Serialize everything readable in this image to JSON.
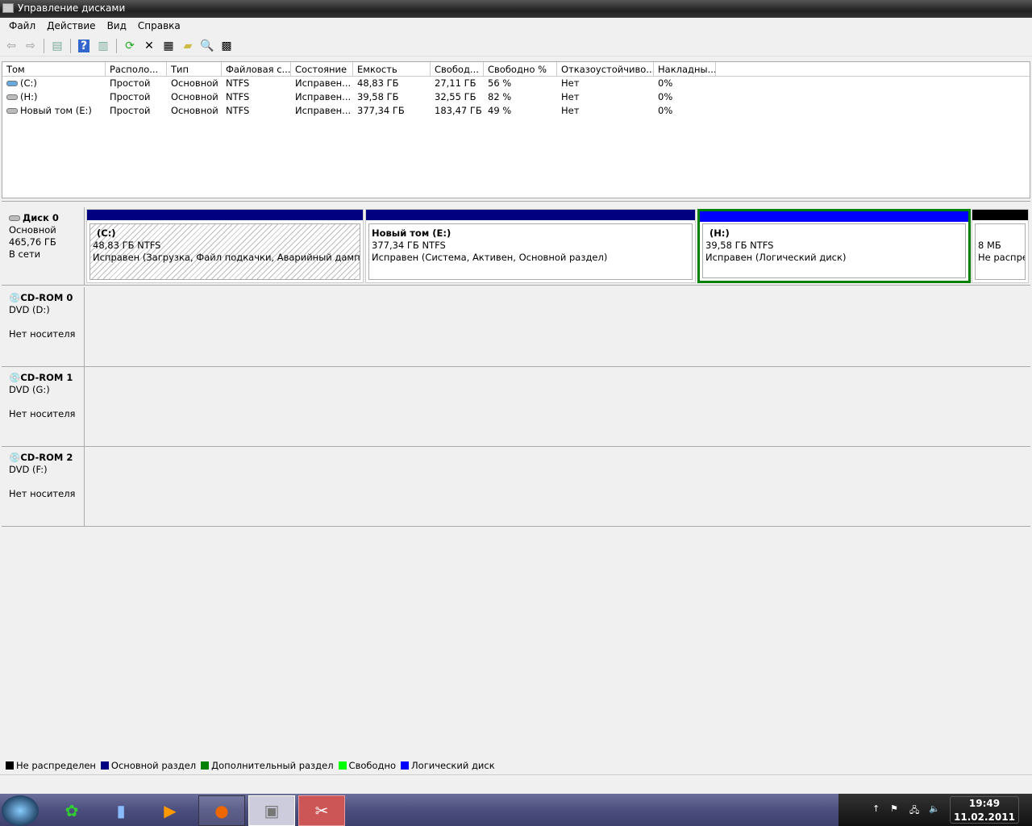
{
  "window": {
    "title": "Управление дисками"
  },
  "menu": [
    "Файл",
    "Действие",
    "Вид",
    "Справка"
  ],
  "toolbar": [
    "back-icon",
    "forward-icon",
    "console-tree-icon",
    "help-icon",
    "action-pane-icon",
    "refresh-icon",
    "delete-icon",
    "properties-icon",
    "open-icon",
    "search-icon",
    "settings-icon"
  ],
  "table": {
    "columns": [
      "Том",
      "Располо...",
      "Тип",
      "Файловая с...",
      "Состояние",
      "Емкость",
      "Свобод...",
      "Свободно %",
      "Отказоустойчиво...",
      "Накладны..."
    ],
    "rows": [
      [
        "(C:)",
        "Простой",
        "Основной",
        "NTFS",
        "Исправен...",
        "48,83 ГБ",
        "27,11 ГБ",
        "56 %",
        "Нет",
        "0%"
      ],
      [
        "(H:)",
        "Простой",
        "Основной",
        "NTFS",
        "Исправен...",
        "39,58 ГБ",
        "32,55 ГБ",
        "82 %",
        "Нет",
        "0%"
      ],
      [
        "Новый том (E:)",
        "Простой",
        "Основной",
        "NTFS",
        "Исправен...",
        "377,34 ГБ",
        "183,47 ГБ",
        "49 %",
        "Нет",
        "0%"
      ]
    ]
  },
  "disks": [
    {
      "name": "Диск 0",
      "type": "Основной",
      "size": "465,76 ГБ",
      "status": "В сети",
      "partitions": [
        {
          "name": "(C:)",
          "size": "48,83 ГБ NTFS",
          "status": "Исправен (Загрузка, Файл подкачки, Аварийный дамп памя",
          "color": "#000080"
        },
        {
          "name": "Новый том  (E:)",
          "size": "377,34 ГБ NTFS",
          "status": "Исправен (Система, Активен, Основной раздел)",
          "color": "#000080"
        },
        {
          "name": "(H:)",
          "size": "39,58 ГБ NTFS",
          "status": "Исправен (Логический диск)",
          "color": "#0000ff"
        },
        {
          "name": "",
          "size": "8 МБ",
          "status": "Не распре",
          "color": "#000000"
        }
      ]
    },
    {
      "name": "CD-ROM 0",
      "type": "DVD (D:)",
      "status": "Нет носителя"
    },
    {
      "name": "CD-ROM 1",
      "type": "DVD (G:)",
      "status": "Нет носителя"
    },
    {
      "name": "CD-ROM 2",
      "type": "DVD (F:)",
      "status": "Нет носителя"
    }
  ],
  "legend": [
    {
      "label": "Не распределен",
      "color": "#000000"
    },
    {
      "label": "Основной раздел",
      "color": "#000080"
    },
    {
      "label": "Дополнительный раздел",
      "color": "#008000"
    },
    {
      "label": "Свободно",
      "color": "#00ff00"
    },
    {
      "label": "Логический диск",
      "color": "#0000ff"
    }
  ],
  "taskbar": {
    "time": "19:49",
    "date": "11.02.2011"
  }
}
